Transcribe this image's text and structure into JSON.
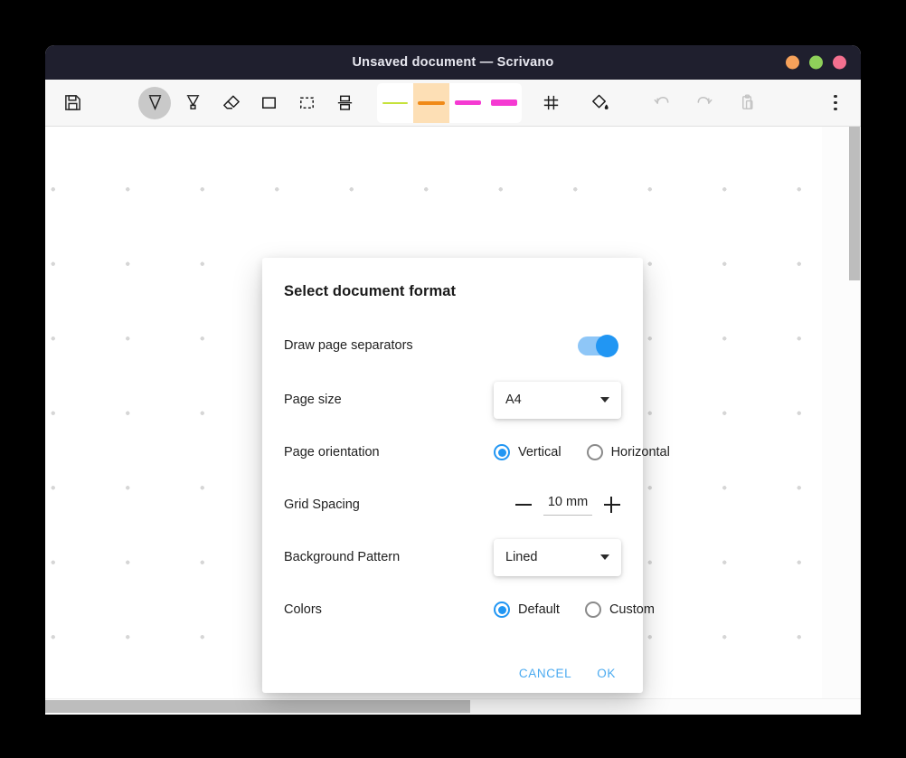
{
  "window": {
    "title": "Unsaved document — Scrivano",
    "controls": [
      {
        "name": "minimize",
        "color": "#f6a15a"
      },
      {
        "name": "maximize",
        "color": "#8fd05a"
      },
      {
        "name": "close",
        "color": "#f4708f"
      }
    ]
  },
  "toolbar": {
    "save_label": "Save",
    "tools": [
      {
        "id": "pen",
        "label": "Pen",
        "active": true
      },
      {
        "id": "highlighter",
        "label": "Highlighter",
        "active": false
      },
      {
        "id": "eraser",
        "label": "Eraser",
        "active": false
      },
      {
        "id": "rectangle",
        "label": "Rectangle",
        "active": false
      },
      {
        "id": "select",
        "label": "Select",
        "active": false
      },
      {
        "id": "spacer",
        "label": "Spacer",
        "active": false
      }
    ],
    "swatches": [
      {
        "color": "#c6e23a",
        "thickness": 2,
        "selected": false
      },
      {
        "color": "#f08a17",
        "thickness": 4,
        "selected": true
      },
      {
        "color": "#f53ad2",
        "thickness": 5,
        "selected": false
      },
      {
        "color": "#f53ad2",
        "thickness": 7,
        "selected": false
      }
    ],
    "extra_tools": [
      {
        "id": "grid",
        "label": "Grid",
        "disabled": false
      },
      {
        "id": "fill",
        "label": "Fill",
        "disabled": false
      },
      {
        "id": "undo",
        "label": "Undo",
        "disabled": true
      },
      {
        "id": "redo",
        "label": "Redo",
        "disabled": true
      },
      {
        "id": "paste",
        "label": "Paste",
        "disabled": true
      }
    ],
    "overflow_label": "More options"
  },
  "dialog": {
    "title": "Select document format",
    "rows": {
      "separators": {
        "label": "Draw page separators",
        "value": "on"
      },
      "page_size": {
        "label": "Page size",
        "value": "A4"
      },
      "orientation": {
        "label": "Page orientation",
        "options": [
          {
            "label": "Vertical",
            "selected": true
          },
          {
            "label": "Horizontal",
            "selected": false
          }
        ]
      },
      "grid_spacing": {
        "label": "Grid Spacing",
        "value": "10 mm",
        "minus_label": "Decrease",
        "plus_label": "Increase"
      },
      "background_pattern": {
        "label": "Background Pattern",
        "value": "Lined"
      },
      "colors": {
        "label": "Colors",
        "options": [
          {
            "label": "Default",
            "selected": true
          },
          {
            "label": "Custom",
            "selected": false
          }
        ]
      }
    },
    "actions": {
      "cancel": "CANCEL",
      "ok": "OK"
    }
  },
  "theme": {
    "titlebar_bg": "#1f1f2e",
    "toolbar_bg": "#f7f7f7",
    "accent": "#2196f3",
    "link": "#4aaaf0",
    "swatch_selected_bg": "#fddfb5"
  }
}
